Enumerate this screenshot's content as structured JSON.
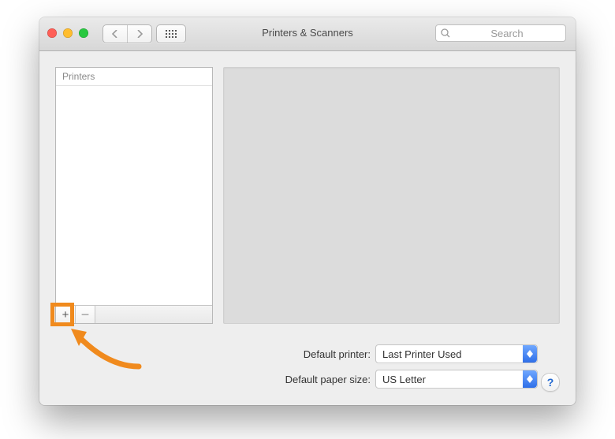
{
  "window": {
    "title": "Printers & Scanners"
  },
  "search": {
    "placeholder": "Search"
  },
  "sidebar": {
    "header": "Printers",
    "add_label": "+",
    "remove_label": "−"
  },
  "form": {
    "default_printer": {
      "label": "Default printer:",
      "value": "Last Printer Used"
    },
    "default_paper_size": {
      "label": "Default paper size:",
      "value": "US Letter"
    }
  },
  "help": {
    "label": "?"
  }
}
